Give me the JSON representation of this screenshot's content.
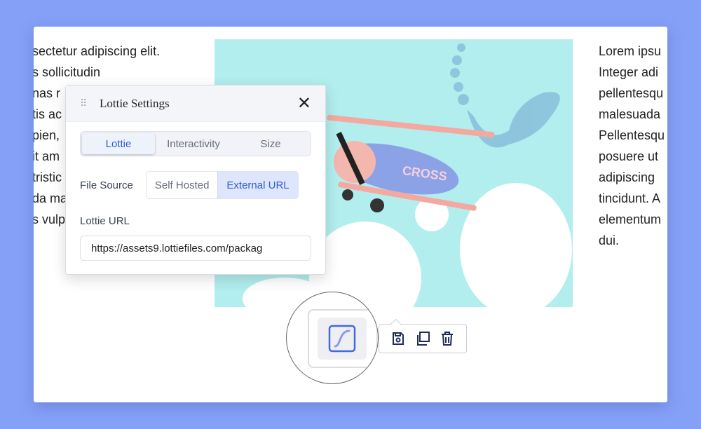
{
  "left_text": [
    "sectetur adipiscing elit.",
    "s sollicitudin",
    "nas r",
    "tis ac",
    "pien,",
    "it am",
    "tristic",
    "da ma",
    "s vulp"
  ],
  "right_text": [
    "Lorem ipsu",
    "Integer adi",
    "pellentesqu",
    "malesuada",
    "Pellentesqu",
    "posuere ut",
    "adipiscing",
    "tincidunt. A",
    "elementum",
    "dui."
  ],
  "image": {
    "caption": "CROSS"
  },
  "panel": {
    "title": "Lottie Settings",
    "tabs": [
      "Lottie",
      "Interactivity",
      "Size"
    ],
    "active_tab": "Lottie",
    "file_source": {
      "label": "File Source",
      "options": [
        "Self Hosted",
        "External URL"
      ],
      "selected": "External URL"
    },
    "url_label": "Lottie URL",
    "url_value": "https://assets9.lottiefiles.com/packag"
  },
  "toolbar": {
    "icons": [
      "lottie-icon",
      "save-icon",
      "duplicate-icon",
      "delete-icon"
    ]
  },
  "colors": {
    "background": "#85a0f7",
    "accent": "#2f5fd0",
    "image_bg": "#b2eeee"
  }
}
